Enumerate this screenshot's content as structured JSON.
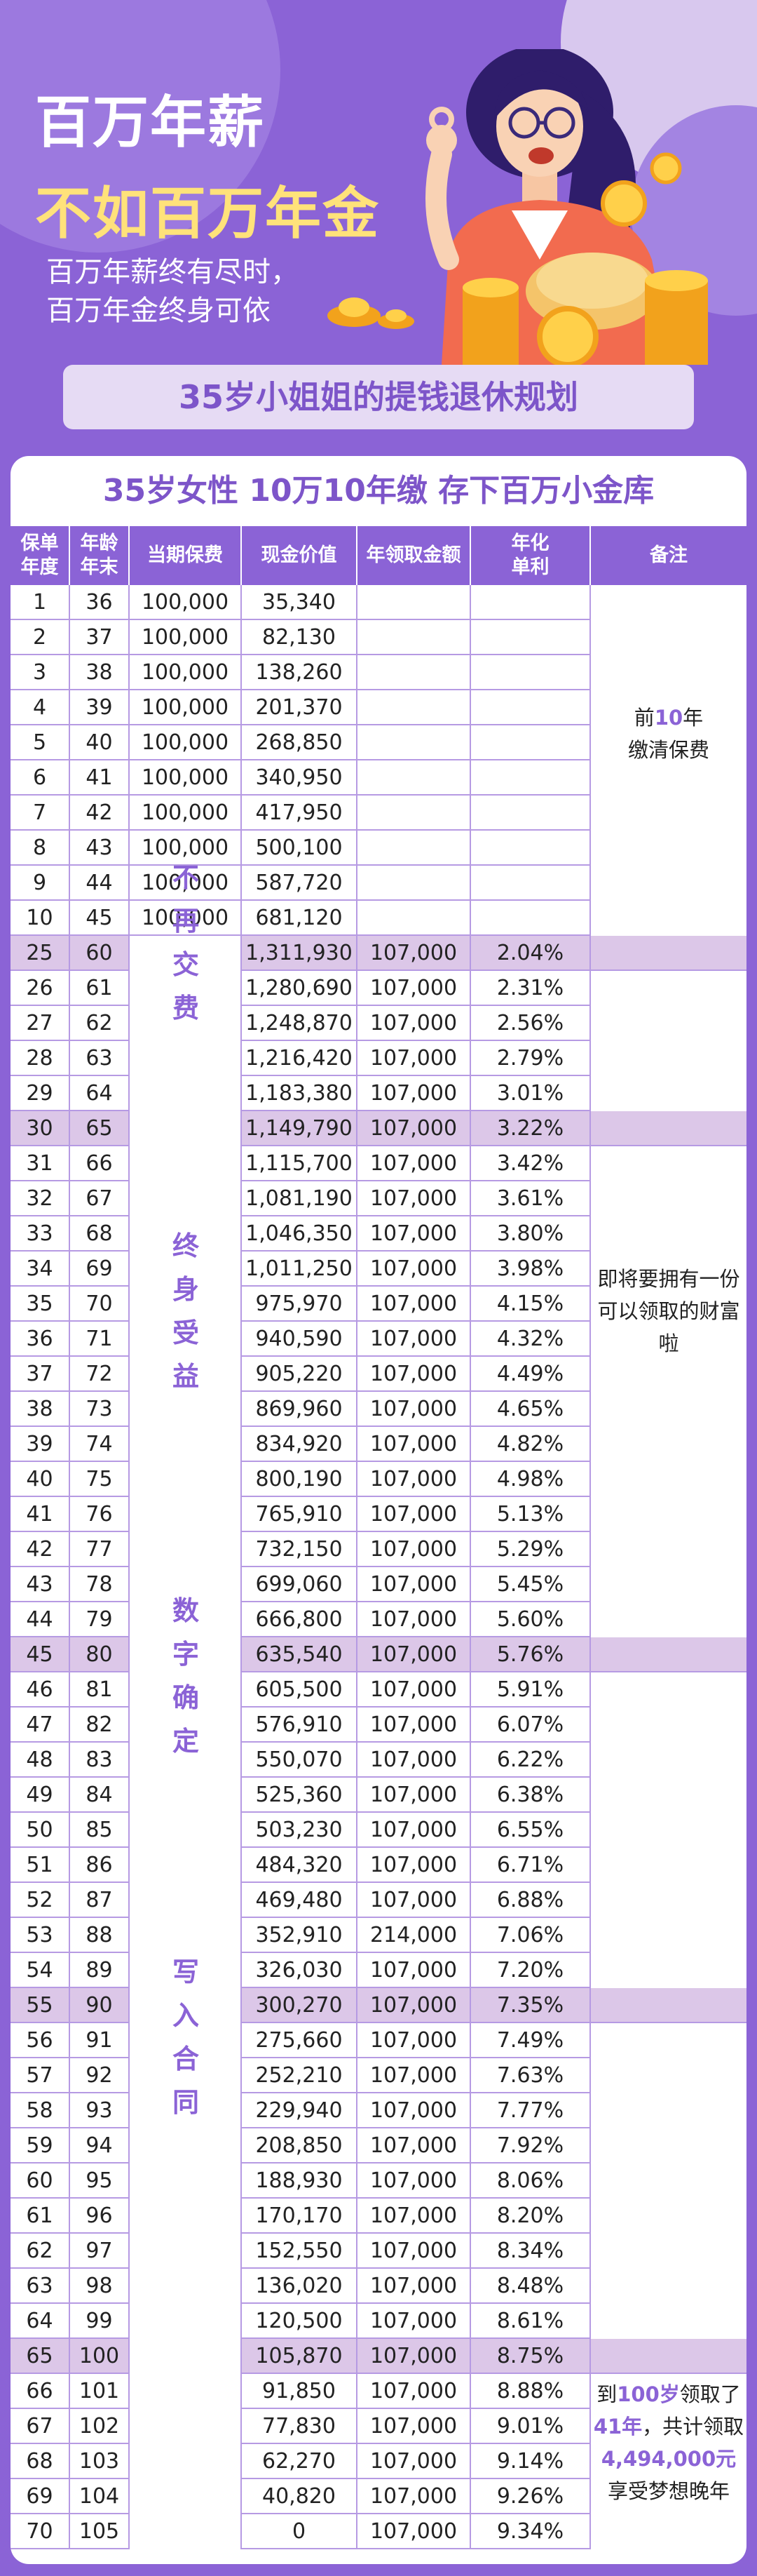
{
  "hero": {
    "title_line1": "百万年薪",
    "title_line2": "不如百万年金",
    "subtitle_line1": "百万年薪终有尽时，",
    "subtitle_line2": "百万年金终身可依",
    "banner": "35岁小姐姐的提钱退休规划"
  },
  "table": {
    "headline": "35岁女性   10万10年缴   存下百万小金库",
    "columns": [
      "保单\n年度",
      "年龄\n年末",
      "当期保费",
      "现金价值",
      "年领取金额",
      "年化\n单利",
      "备注"
    ],
    "rows": [
      [
        "1",
        "36",
        "100,000",
        "35,340",
        "",
        ""
      ],
      [
        "2",
        "37",
        "100,000",
        "82,130",
        "",
        ""
      ],
      [
        "3",
        "38",
        "100,000",
        "138,260",
        "",
        ""
      ],
      [
        "4",
        "39",
        "100,000",
        "201,370",
        "",
        ""
      ],
      [
        "5",
        "40",
        "100,000",
        "268,850",
        "",
        ""
      ],
      [
        "6",
        "41",
        "100,000",
        "340,950",
        "",
        ""
      ],
      [
        "7",
        "42",
        "100,000",
        "417,950",
        "",
        ""
      ],
      [
        "8",
        "43",
        "100,000",
        "500,100",
        "",
        ""
      ],
      [
        "9",
        "44",
        "100,000",
        "587,720",
        "",
        ""
      ],
      [
        "10",
        "45",
        "100,000",
        "681,120",
        "",
        ""
      ],
      [
        "25",
        "60",
        "",
        "1,311,930",
        "107,000",
        "2.04%"
      ],
      [
        "26",
        "61",
        "",
        "1,280,690",
        "107,000",
        "2.31%"
      ],
      [
        "27",
        "62",
        "",
        "1,248,870",
        "107,000",
        "2.56%"
      ],
      [
        "28",
        "63",
        "",
        "1,216,420",
        "107,000",
        "2.79%"
      ],
      [
        "29",
        "64",
        "",
        "1,183,380",
        "107,000",
        "3.01%"
      ],
      [
        "30",
        "65",
        "",
        "1,149,790",
        "107,000",
        "3.22%"
      ],
      [
        "31",
        "66",
        "",
        "1,115,700",
        "107,000",
        "3.42%"
      ],
      [
        "32",
        "67",
        "",
        "1,081,190",
        "107,000",
        "3.61%"
      ],
      [
        "33",
        "68",
        "",
        "1,046,350",
        "107,000",
        "3.80%"
      ],
      [
        "34",
        "69",
        "",
        "1,011,250",
        "107,000",
        "3.98%"
      ],
      [
        "35",
        "70",
        "",
        "975,970",
        "107,000",
        "4.15%"
      ],
      [
        "36",
        "71",
        "",
        "940,590",
        "107,000",
        "4.32%"
      ],
      [
        "37",
        "72",
        "",
        "905,220",
        "107,000",
        "4.49%"
      ],
      [
        "38",
        "73",
        "",
        "869,960",
        "107,000",
        "4.65%"
      ],
      [
        "39",
        "74",
        "",
        "834,920",
        "107,000",
        "4.82%"
      ],
      [
        "40",
        "75",
        "",
        "800,190",
        "107,000",
        "4.98%"
      ],
      [
        "41",
        "76",
        "",
        "765,910",
        "107,000",
        "5.13%"
      ],
      [
        "42",
        "77",
        "",
        "732,150",
        "107,000",
        "5.29%"
      ],
      [
        "43",
        "78",
        "",
        "699,060",
        "107,000",
        "5.45%"
      ],
      [
        "44",
        "79",
        "",
        "666,800",
        "107,000",
        "5.60%"
      ],
      [
        "45",
        "80",
        "",
        "635,540",
        "107,000",
        "5.76%"
      ],
      [
        "46",
        "81",
        "",
        "605,500",
        "107,000",
        "5.91%"
      ],
      [
        "47",
        "82",
        "",
        "576,910",
        "107,000",
        "6.07%"
      ],
      [
        "48",
        "83",
        "",
        "550,070",
        "107,000",
        "6.22%"
      ],
      [
        "49",
        "84",
        "",
        "525,360",
        "107,000",
        "6.38%"
      ],
      [
        "50",
        "85",
        "",
        "503,230",
        "107,000",
        "6.55%"
      ],
      [
        "51",
        "86",
        "",
        "484,320",
        "107,000",
        "6.71%"
      ],
      [
        "52",
        "87",
        "",
        "469,480",
        "107,000",
        "6.88%"
      ],
      [
        "53",
        "88",
        "",
        "352,910",
        "214,000",
        "7.06%"
      ],
      [
        "54",
        "89",
        "",
        "326,030",
        "107,000",
        "7.20%"
      ],
      [
        "55",
        "90",
        "",
        "300,270",
        "107,000",
        "7.35%"
      ],
      [
        "56",
        "91",
        "",
        "275,660",
        "107,000",
        "7.49%"
      ],
      [
        "57",
        "92",
        "",
        "252,210",
        "107,000",
        "7.63%"
      ],
      [
        "58",
        "93",
        "",
        "229,940",
        "107,000",
        "7.77%"
      ],
      [
        "59",
        "94",
        "",
        "208,850",
        "107,000",
        "7.92%"
      ],
      [
        "60",
        "95",
        "",
        "188,930",
        "107,000",
        "8.06%"
      ],
      [
        "61",
        "96",
        "",
        "170,170",
        "107,000",
        "8.20%"
      ],
      [
        "62",
        "97",
        "",
        "152,550",
        "107,000",
        "8.34%"
      ],
      [
        "63",
        "98",
        "",
        "136,020",
        "107,000",
        "8.48%"
      ],
      [
        "64",
        "99",
        "",
        "120,500",
        "107,000",
        "8.61%"
      ],
      [
        "65",
        "100",
        "",
        "105,870",
        "107,000",
        "8.75%"
      ],
      [
        "66",
        "101",
        "",
        "91,850",
        "107,000",
        "8.88%"
      ],
      [
        "67",
        "102",
        "",
        "77,830",
        "107,000",
        "9.01%"
      ],
      [
        "68",
        "103",
        "",
        "62,270",
        "107,000",
        "9.14%"
      ],
      [
        "69",
        "104",
        "",
        "40,820",
        "107,000",
        "9.26%"
      ],
      [
        "70",
        "105",
        "",
        "0",
        "107,000",
        "9.34%"
      ]
    ],
    "highlight_years": [
      "25",
      "30",
      "45",
      "55",
      "65"
    ],
    "vertical_labels": [
      "不再交费",
      "终身受益",
      "数字确定",
      "写入合同"
    ],
    "note_1": [
      "前",
      "10",
      "年",
      "缴清保费"
    ],
    "note_2": [
      "即将要拥有一份",
      "可以领取的财富",
      "啦"
    ],
    "note_3": [
      "到",
      "100岁",
      "领取了",
      "41年",
      "，共计领取",
      "4,494,000元",
      "享受梦想晚年"
    ]
  },
  "colors": {
    "accent": "#8b63d6",
    "title_yellow": "#ffe27a",
    "row_highlight": "#dcc7e8",
    "banner_bg": "#e6dbf4"
  }
}
